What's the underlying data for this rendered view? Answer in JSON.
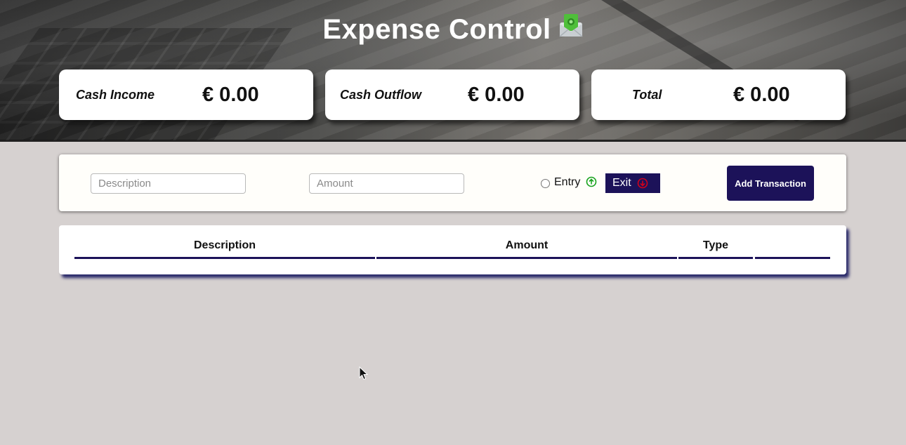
{
  "header": {
    "title": "Expense Control",
    "title_icon": "money-envelope-icon"
  },
  "summary": {
    "income": {
      "label": "Cash Income",
      "value": "€ 0.00"
    },
    "outflow": {
      "label": "Cash Outflow",
      "value": "€ 0.00"
    },
    "total": {
      "label": "Total",
      "value": "€ 0.00"
    }
  },
  "form": {
    "description": {
      "placeholder": "Description",
      "value": ""
    },
    "amount": {
      "placeholder": "Amount",
      "value": ""
    },
    "entry": {
      "label": "Entry",
      "icon": "arrow-up-circle-icon",
      "selected": false
    },
    "exit": {
      "label": "Exit",
      "icon": "arrow-down-circle-icon"
    },
    "add_button": "Add Transaction"
  },
  "table": {
    "columns": [
      "Description",
      "Amount",
      "Type",
      ""
    ],
    "rows": []
  },
  "colors": {
    "primary": "#1c1259",
    "background": "#d6d1d0",
    "entry_icon": "#18a31e",
    "exit_icon": "#d0021b"
  }
}
